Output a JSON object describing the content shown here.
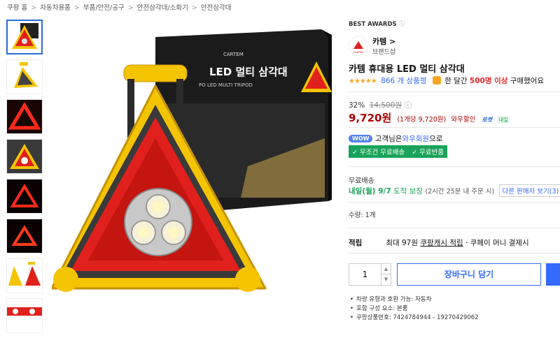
{
  "breadcrumb": [
    "쿠팡 홈",
    "자동차용품",
    "부품/안전/공구",
    "안전삼각대/소화기",
    "안전삼각대"
  ],
  "product": {
    "best_awards": "BEST AWARDS",
    "brand_name": "카템 >",
    "brand_shop": "브랜드샵",
    "brand_logo_text": "CARTEM",
    "title": "카템 휴대용 LED 멀티 삼각대",
    "rating_stars": "★★★★★",
    "rating_value": 5,
    "review_count": "866 개 상품평",
    "buy_note_prefix": "한 달간",
    "buy_count": "500명 이상",
    "buy_note_suffix": "구매했어요",
    "box_text_1": "CARTEM",
    "box_text_2": "LED 멀티 삼각대",
    "box_text_3": "PO       LED MULTI TRIPOD"
  },
  "price": {
    "discount": "32%",
    "original": "14,500원",
    "sale": "9,720원",
    "unit": "(1개당 9,720원)",
    "wow_sale": "와우할인",
    "rocket": "로켓",
    "daily": "내일"
  },
  "wow": {
    "pill": "WOW",
    "prefix": "고객님은",
    "link": "와우회원",
    "suffix": "으로",
    "tags": [
      "✓ 무조건 무료배송",
      "✓ 무료반품"
    ]
  },
  "shipping": {
    "label": "무료배송",
    "date": "내일(월) 9/7",
    "arrive": "도착 보장",
    "note": "(2시간 25분 내 주문 시)",
    "other_sellers": "다른 판매자 보기(3)"
  },
  "quantity_label": "수량: 1개",
  "accrual": {
    "title": "적립",
    "text1": "최대 97원",
    "cash": "쿠팡캐시 적립",
    "text2": "· 쿠페이 머니 결제시"
  },
  "quantity_value": "1",
  "cart_button": "장바구니 담기",
  "bullets": [
    "차량 유형과 호환 가능: 자동차",
    "포함 구성 요소: 본품",
    "쿠팡상품번호: 7424784944 - 19270429062"
  ],
  "colors": {
    "accent": "#346aff",
    "price": "#ae0000",
    "green": "#1aa35a",
    "yellow": "#f5c400",
    "red": "#e0201c"
  }
}
